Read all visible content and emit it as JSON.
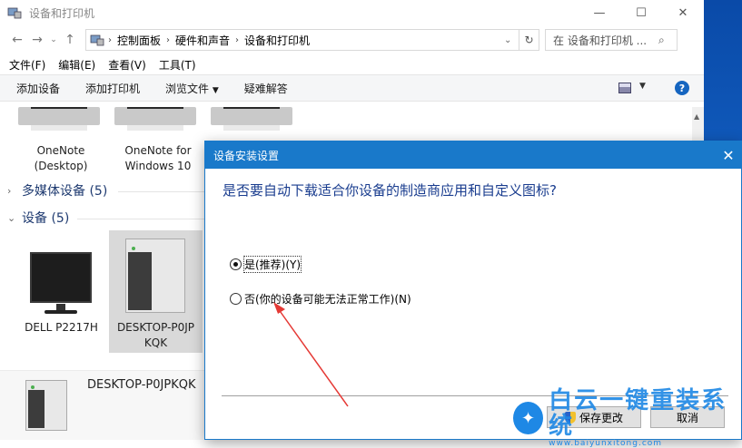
{
  "window": {
    "title": "设备和打印机",
    "minimize": "—",
    "maximize": "☐",
    "close": "✕"
  },
  "address": {
    "crumbs": [
      "控制面板",
      "硬件和声音",
      "设备和打印机"
    ],
    "search_placeholder": "在 设备和打印机 ..."
  },
  "menu": [
    "文件(F)",
    "编辑(E)",
    "查看(V)",
    "工具(T)"
  ],
  "toolbar": {
    "add_device": "添加设备",
    "add_printer": "添加打印机",
    "browse_files": "浏览文件",
    "troubleshoot": "疑难解答",
    "help": "?"
  },
  "printers": [
    {
      "line1": "OneNote",
      "line2": "(Desktop)"
    },
    {
      "line1": "OneNote for",
      "line2": "Windows 10"
    }
  ],
  "groups": {
    "multimedia": "多媒体设备 (5)",
    "devices": "设备 (5)"
  },
  "devices": [
    {
      "label": "DELL P2217H"
    },
    {
      "line1": "DESKTOP-P0JP",
      "line2": "KQK"
    }
  ],
  "details": {
    "name": "DESKTOP-P0JPKQK"
  },
  "dialog": {
    "title": "设备安装设置",
    "question": "是否要自动下载适合你设备的制造商应用和自定义图标?",
    "options": [
      {
        "label": "是(推荐)(Y)",
        "checked": true
      },
      {
        "label": "否(你的设备可能无法正常工作)(N)",
        "checked": false
      }
    ],
    "save_button": "保存更改",
    "cancel_button": "取消"
  },
  "watermark": {
    "text": "白云一键重装系统",
    "url": "www.baiyunxitong.com"
  },
  "colors": {
    "dialog_title_bg": "#1979ca",
    "question_text": "#1a3d8f",
    "annotation_arrow": "#e53935",
    "watermark": "#1e88e5"
  }
}
